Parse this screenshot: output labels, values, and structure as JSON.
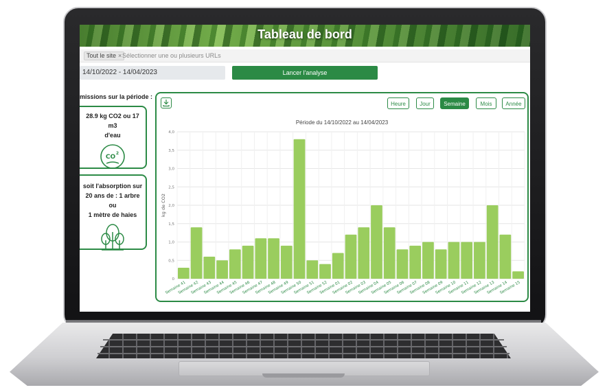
{
  "header": {
    "title": "Tableau de bord"
  },
  "url_filter": {
    "tag": "Tout le site",
    "tag_remove": "×",
    "placeholder": "Sélectionner une ou plusieurs URLs"
  },
  "date_range": "14/10/2022 - 14/04/2023",
  "launch_label": "Lancer l'analyse",
  "emissions_title": "missions sur la période :",
  "card_co2": {
    "line1": "28.9 kg CO2 ou 17 m3",
    "line2": "d'eau",
    "icon": "co2-icon"
  },
  "card_absorption": {
    "line1": "soit l'absorption sur",
    "line2": "20 ans de : 1 arbre ou",
    "line3": "1 mètre de haies",
    "icon": "tree-icon"
  },
  "period_buttons": [
    {
      "label": "Heure"
    },
    {
      "label": "Jour"
    },
    {
      "label": "Semaine"
    },
    {
      "label": "Mois"
    },
    {
      "label": "Année"
    }
  ],
  "active_period": "Semaine",
  "colors": {
    "accent": "#2b8a45",
    "bar": "#9acd5e"
  },
  "chart_data": {
    "type": "bar",
    "title": "Période du 14/10/2022 au 14/04/2023",
    "xlabel": "",
    "ylabel": "kg de CO2",
    "ylim": [
      0,
      4
    ],
    "yticks": [
      "0",
      "0,5",
      "1,0",
      "1,5",
      "2,0",
      "2,5",
      "3,0",
      "3,5",
      "4,0"
    ],
    "grid": true,
    "categories": [
      "Semaine 41",
      "Semaine 42",
      "Semaine 43",
      "Semaine 44",
      "Semaine 45",
      "Semaine 46",
      "Semaine 47",
      "Semaine 48",
      "Semaine 49",
      "Semaine 50",
      "Semaine 51",
      "Semaine 52",
      "Semaine 01",
      "Semaine 02",
      "Semaine 03",
      "Semaine 04",
      "Semaine 05",
      "Semaine 06",
      "Semaine 07",
      "Semaine 08",
      "Semaine 09",
      "Semaine 10",
      "Semaine 11",
      "Semaine 12",
      "Semaine 13",
      "Semaine 14",
      "Semaine 15"
    ],
    "values": [
      0.3,
      1.4,
      0.6,
      0.5,
      0.8,
      0.9,
      1.1,
      1.1,
      0.9,
      3.8,
      0.5,
      0.4,
      0.7,
      1.2,
      1.4,
      2.0,
      1.4,
      0.8,
      0.9,
      1.0,
      0.8,
      1.0,
      1.0,
      1.0,
      2.0,
      1.2,
      0.2
    ]
  }
}
